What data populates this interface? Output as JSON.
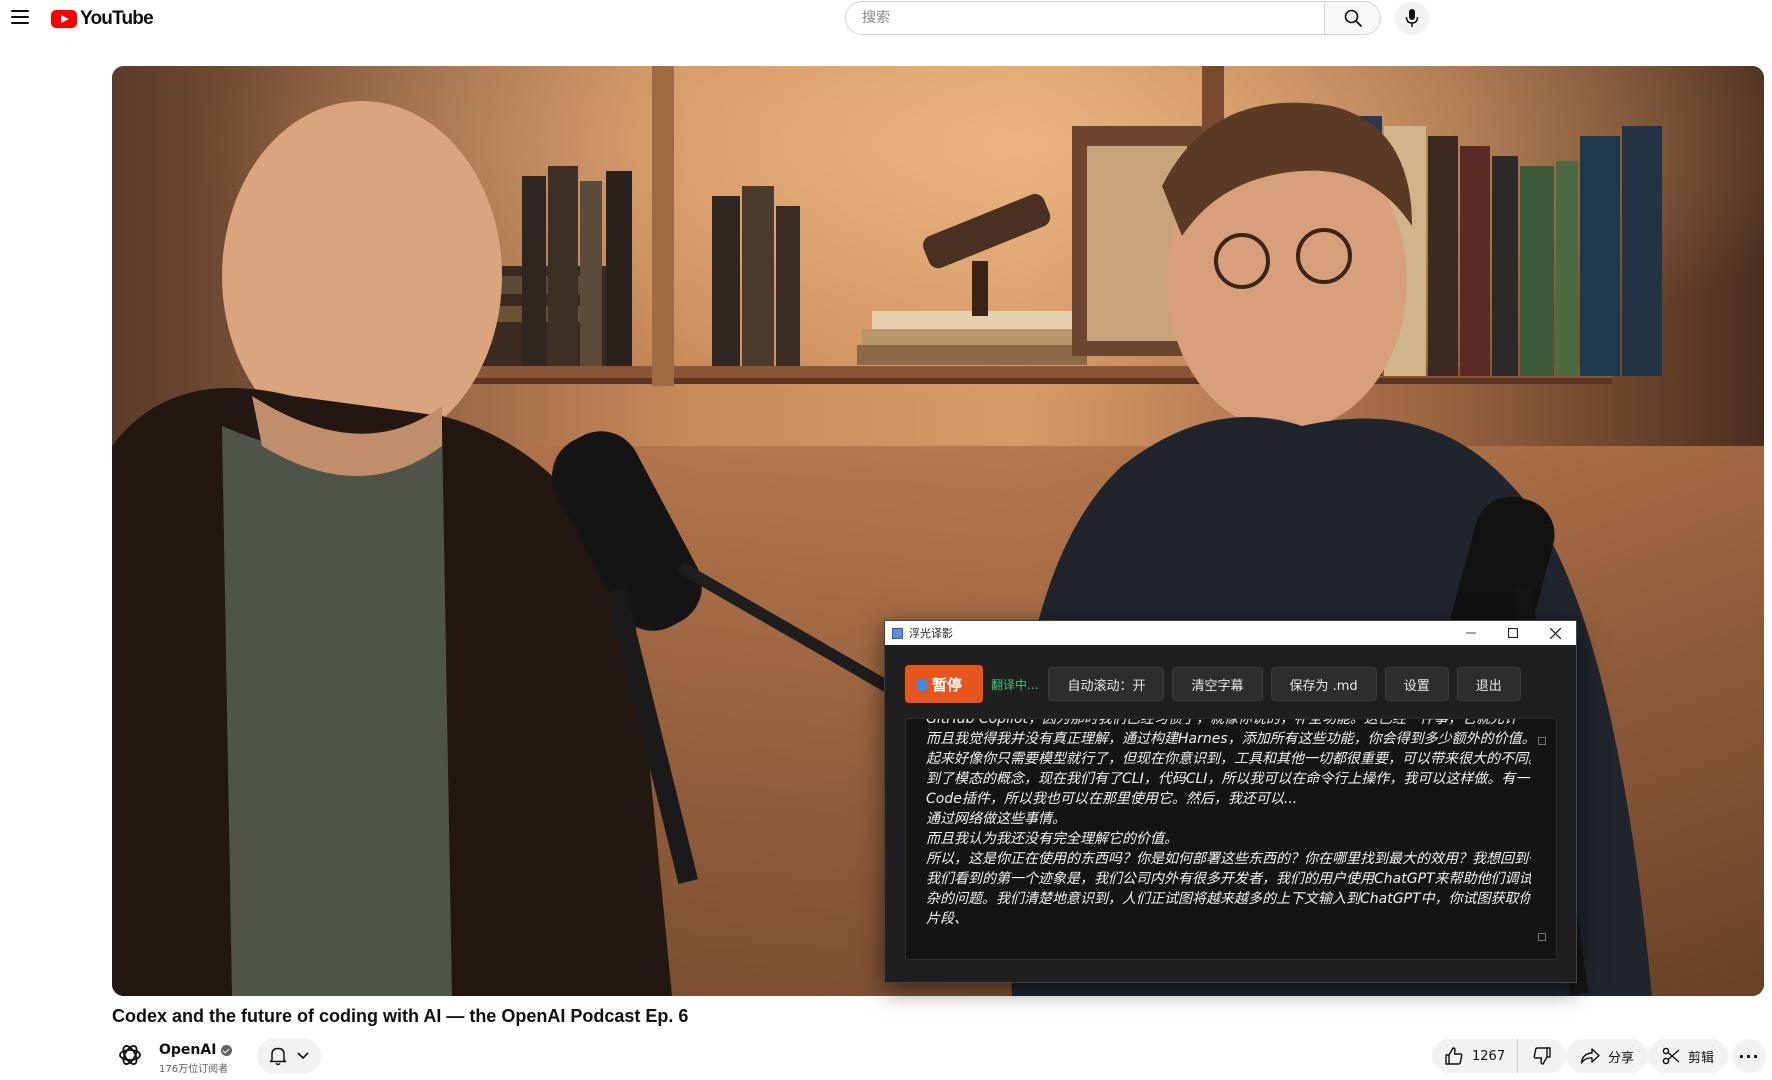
{
  "header": {
    "logo_text": "YouTube",
    "search_placeholder": "搜索"
  },
  "translator": {
    "window_title": "浮光译影",
    "pause_label": "暂停",
    "status": "翻译中...",
    "autoscroll_label": "自动滚动：开",
    "clear_label": "清空字幕",
    "save_label": "保存为 .md",
    "settings_label": "设置",
    "exit_label": "退出",
    "subtitle_lines": [
      "GitHub Copilot，因为那时我们已经习惯了，就像你说的，补全功能。这已经一件事，它就允许一件事。",
      "而且我觉得我并没有真正理解，通过构建Harnes，添加所有这些功能，你会得到多少额外的价值。当时看",
      "起来好像你只需要模型就行了，但现在你意识到，工具和其他一切都很重要，可以带来很大的不同。你提",
      "到了模态的概念，现在我们有了CLI，代码CLI，所以我可以在命令行上操作，我可以这样做。有一个VS",
      "Code插件，所以我也可以在那里使用它。然后，我还可以...",
      "通过网络做这些事情。",
      "而且我认为我还没有完全理解它的价值。",
      "所以，这是你正在使用的东西吗？你是如何部署这些东西的？你在哪里找到最大的效用？我想回到一点，",
      "我们看到的第一个迹象是，我们公司内外有很多开发者，我们的用户使用ChatGPT来帮助他们调试非常复",
      "杂的问题。我们清楚地意识到，人们正试图将越来越多的上下文输入到ChatGPT中，你试图获取你的代码",
      "片段、"
    ]
  },
  "video": {
    "title": "Codex and the future of coding with AI — the OpenAI Podcast Ep. 6"
  },
  "channel": {
    "name": "OpenAI",
    "subscribers": "176万位订阅者"
  },
  "actions": {
    "like_count": "1267",
    "share_label": "分享",
    "clip_label": "剪辑"
  }
}
